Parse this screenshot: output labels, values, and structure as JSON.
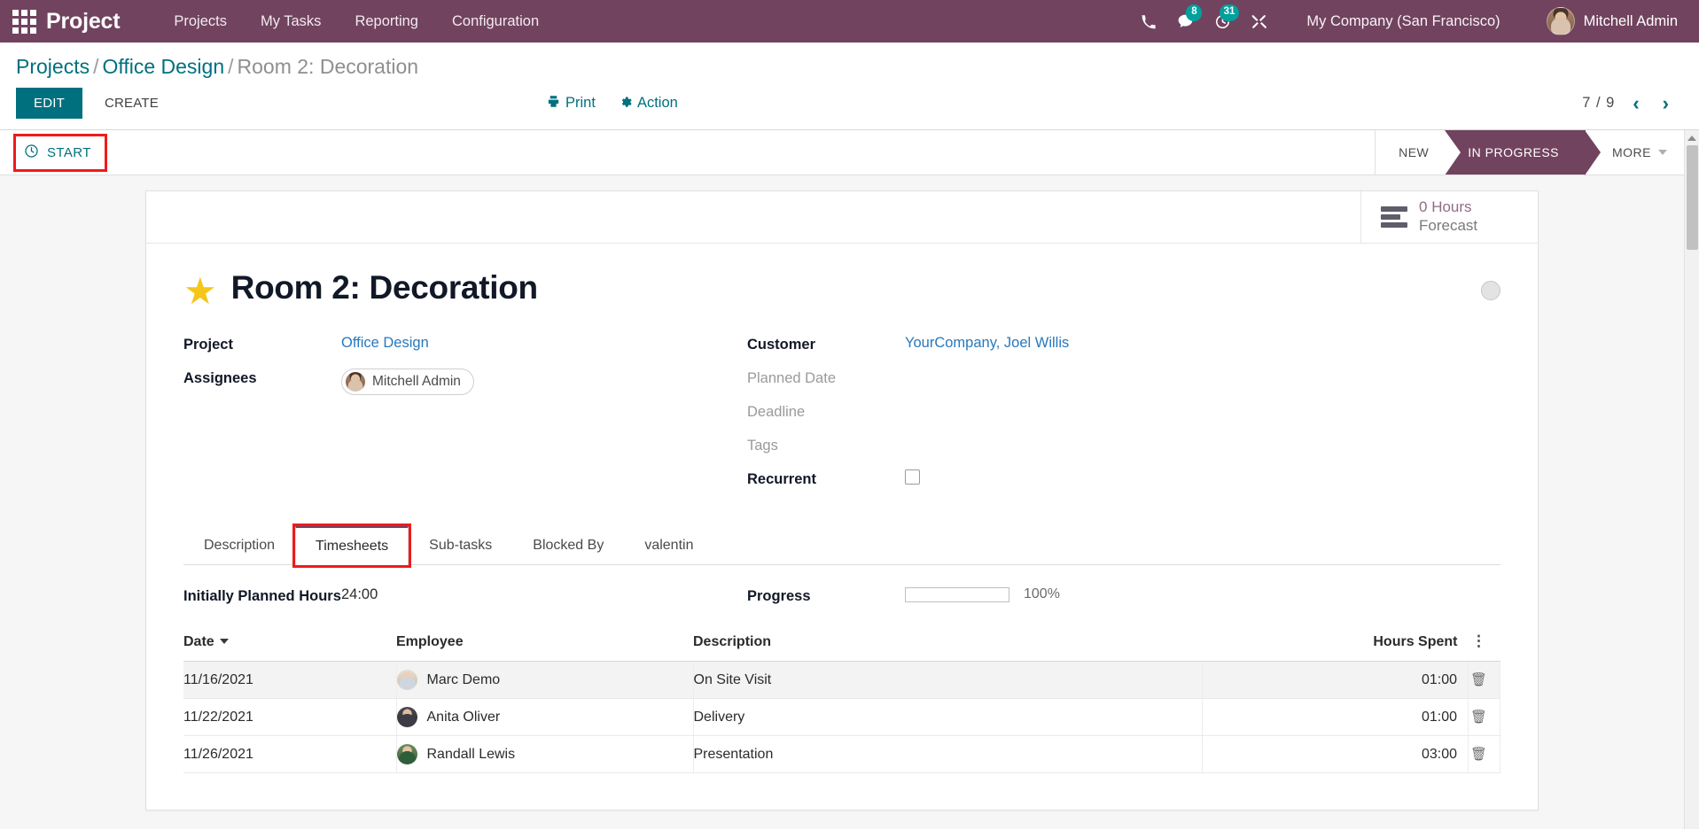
{
  "navbar": {
    "apps_icon": "apps-grid-icon",
    "brand": "Project",
    "menu": [
      {
        "label": "Projects"
      },
      {
        "label": "My Tasks"
      },
      {
        "label": "Reporting"
      },
      {
        "label": "Configuration"
      }
    ],
    "icons": [
      {
        "name": "phone-icon",
        "badge": ""
      },
      {
        "name": "messages-icon",
        "badge": "8"
      },
      {
        "name": "activities-clock-icon",
        "badge": "31"
      },
      {
        "name": "developer-tools-icon",
        "badge": ""
      }
    ],
    "company": "My Company (San Francisco)",
    "user": "Mitchell Admin",
    "badge_color": "#00a09d",
    "background_color": "#71435f"
  },
  "breadcrumb": {
    "root": "Projects",
    "parent": "Office Design",
    "current": "Room 2: Decoration",
    "separator": "/"
  },
  "control_panel": {
    "edit_label": "EDIT",
    "create_label": "CREATE",
    "print_label": "Print",
    "action_label": "Action",
    "pager_value": "7 / 9",
    "prev_label": "‹",
    "next_label": "›"
  },
  "statusbar": {
    "start_label": "START",
    "stages": [
      {
        "label": "NEW",
        "active": false
      },
      {
        "label": "IN PROGRESS",
        "active": true
      },
      {
        "label": "MORE",
        "active": false,
        "has_caret": true
      }
    ],
    "active_color": "#71435f"
  },
  "stat_button": {
    "value": "0",
    "unit": "Hours",
    "label": "Forecast",
    "icon": "forecast-bars-icon"
  },
  "record": {
    "title": "Room 2: Decoration",
    "starred": true,
    "star_color": "#f5c518"
  },
  "fields_left": [
    {
      "label": "Project",
      "value": "Office Design",
      "type": "link",
      "empty": false
    },
    {
      "label": "Assignees",
      "value": "Mitchell Admin",
      "type": "tag",
      "empty": false
    }
  ],
  "fields_right": [
    {
      "label": "Customer",
      "value": "YourCompany, Joel Willis",
      "type": "link",
      "empty": false
    },
    {
      "label": "Planned Date",
      "value": "",
      "type": "text",
      "empty": true
    },
    {
      "label": "Deadline",
      "value": "",
      "type": "text",
      "empty": true
    },
    {
      "label": "Tags",
      "value": "",
      "type": "text",
      "empty": true
    },
    {
      "label": "Recurrent",
      "value": "",
      "type": "checkbox",
      "empty": false,
      "checked": false
    }
  ],
  "notebook": {
    "tabs": [
      {
        "label": "Description",
        "active": false
      },
      {
        "label": "Timesheets",
        "active": true,
        "highlighted": true
      },
      {
        "label": "Sub-tasks",
        "active": false
      },
      {
        "label": "Blocked By",
        "active": false
      },
      {
        "label": "valentin",
        "active": false
      }
    ]
  },
  "timesheets": {
    "planned_label": "Initially Planned Hours",
    "planned_value": "24:00",
    "progress_label": "Progress",
    "progress_value": "100%",
    "progress_percent": 100,
    "progress_color": "#00808d",
    "columns": {
      "date": "Date",
      "employee": "Employee",
      "description": "Description",
      "hours": "Hours Spent",
      "options": "⋮"
    },
    "rows": [
      {
        "date": "11/16/2021",
        "employee": "Marc Demo",
        "description": "On Site Visit",
        "hours": "01:00",
        "avatar": "emp-a1"
      },
      {
        "date": "11/22/2021",
        "employee": "Anita Oliver",
        "description": "Delivery",
        "hours": "01:00",
        "avatar": "emp-a2"
      },
      {
        "date": "11/26/2021",
        "employee": "Randall Lewis",
        "description": "Presentation",
        "hours": "03:00",
        "avatar": "emp-a3"
      }
    ]
  }
}
